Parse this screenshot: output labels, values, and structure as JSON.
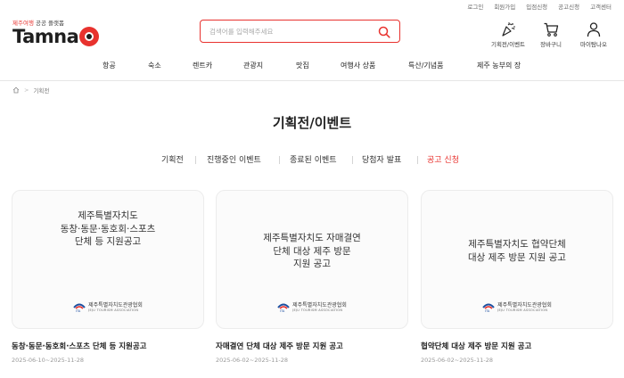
{
  "util_links": [
    "로그인",
    "회원가입",
    "입점신청",
    "공고신청",
    "고객센터"
  ],
  "logo": {
    "tag_red": "제주여행",
    "tag_gray": " 공공 플랫폼",
    "word": "Tamna"
  },
  "search": {
    "placeholder": "검색어를 입력해주세요"
  },
  "header_icons": [
    {
      "icon": "party-popper-icon",
      "label": "기획전/이벤트"
    },
    {
      "icon": "cart-icon",
      "label": "장바구니"
    },
    {
      "icon": "user-icon",
      "label": "마이탐나오"
    }
  ],
  "nav": [
    "항공",
    "숙소",
    "렌트카",
    "관광지",
    "맛집",
    "여행사 상품",
    "특산/기념품",
    "제주 농부의 장"
  ],
  "breadcrumb": {
    "current": "기획전"
  },
  "page_title": "기획전/이벤트",
  "tabs": [
    {
      "label": "기획전",
      "active": false
    },
    {
      "label": "진행중인 이벤트",
      "active": false
    },
    {
      "label": "종료된 이벤트",
      "active": false
    },
    {
      "label": "당첨자 발표",
      "active": false
    },
    {
      "label": "공고 신청",
      "active": true
    }
  ],
  "cards": [
    {
      "lines": [
        "제주특별자치도",
        "동창·동문·동호회·스포츠",
        "단체 등 지원공고"
      ],
      "org_ko": "제주특별자치도관광협회",
      "org_en": "JEJU TOURISM ASSOCIATION",
      "title": "동창·동문·동호회·스포츠 단체 등 지원공고",
      "date": "2025-06-10~2025-11-28"
    },
    {
      "lines": [
        "제주특별자치도 자매결연",
        "단체 대상 제주 방문",
        "지원 공고"
      ],
      "org_ko": "제주특별자치도관광협회",
      "org_en": "JEJU TOURISM ASSOCIATION",
      "title": "자매결연 단체 대상 제주 방문 지원 공고",
      "date": "2025-06-02~2025-11-28"
    },
    {
      "lines": [
        "제주특별자치도 협약단체",
        "대상 제주 방문 지원 공고"
      ],
      "org_ko": "제주특별자치도관광협회",
      "org_en": "JEJU TOURISM ASSOCIATION",
      "title": "협약단체 대상 제주 방문 지원 공고",
      "date": "2025-06-02~2025-11-28"
    }
  ],
  "colors": {
    "accent": "#e8322e",
    "text": "#222222",
    "muted": "#999999"
  }
}
